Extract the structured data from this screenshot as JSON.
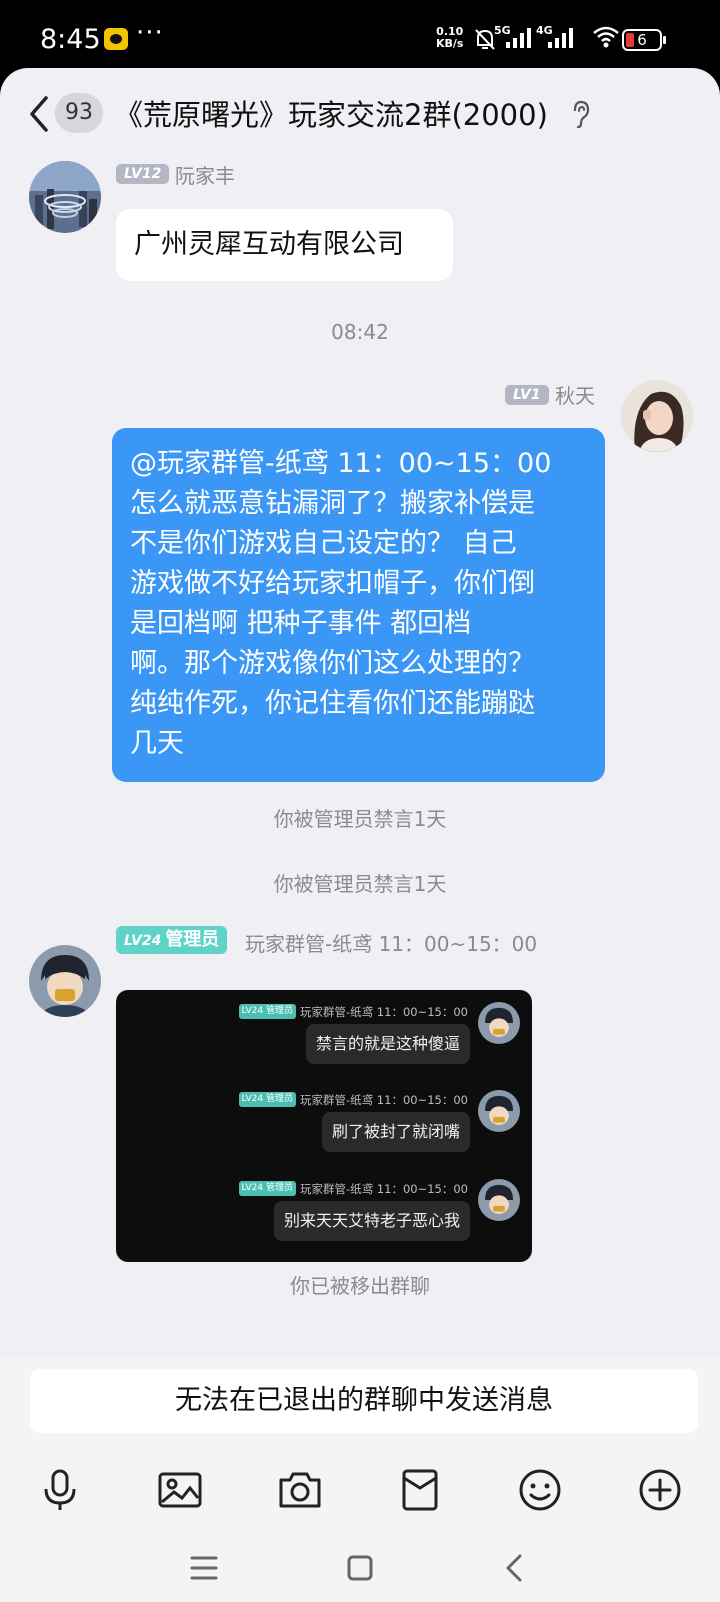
{
  "status_bar": {
    "time": "8:45",
    "more_indicator": "···",
    "speed_value": "0.10",
    "speed_unit": "KB/s",
    "net_5g": "5G",
    "net_4g": "4G",
    "battery": "6"
  },
  "header": {
    "unread_count": "93",
    "title": "《荒原曙光》玩家交流2群(2000)"
  },
  "messages": {
    "m1": {
      "level": "LV12",
      "sender": "阮家丰",
      "text": "广州灵犀互动有限公司"
    },
    "time_divider": "08:42",
    "m2": {
      "level": "LV1",
      "sender": "秋天",
      "lines": [
        "@玩家群管-纸鸢 11：00~15：00",
        "怎么就恶意钻漏洞了？搬家补偿是",
        "不是你们游戏自己设定的？ 自己",
        "游戏做不好给玩家扣帽子，你们倒",
        "是回档啊  把种子事件  都回档",
        "啊。那个游戏像你们这么处理的？",
        "纯纯作死，你记住看你们还能蹦跶",
        "几天"
      ]
    },
    "sys1": "你被管理员禁言1天",
    "sys2": "你被管理员禁言1天",
    "m3": {
      "level": "LV24",
      "role": "管理员",
      "sender": "玩家群管-纸鸢 11：00~15：00",
      "screenshot": {
        "badge": "LV24 管理员",
        "sender": "玩家群管-纸鸢 11：00~15：00",
        "bubbles": [
          "禁言的就是这种傻逼",
          "刷了被封了就闭嘴",
          "别来天天艾特老子恶心我"
        ]
      }
    },
    "sys3": "你已被移出群聊"
  },
  "input": {
    "disabled_text": "无法在已退出的群聊中发送消息"
  },
  "toolbar": [
    "mic-icon",
    "image-icon",
    "camera-icon",
    "red-packet-icon",
    "emoji-icon",
    "plus-icon"
  ],
  "colors": {
    "bubble_self": "#3b97f5",
    "badge_admin": "#5fd3c8",
    "badge_level": "#b3b6c3",
    "background": "#efeff4"
  }
}
